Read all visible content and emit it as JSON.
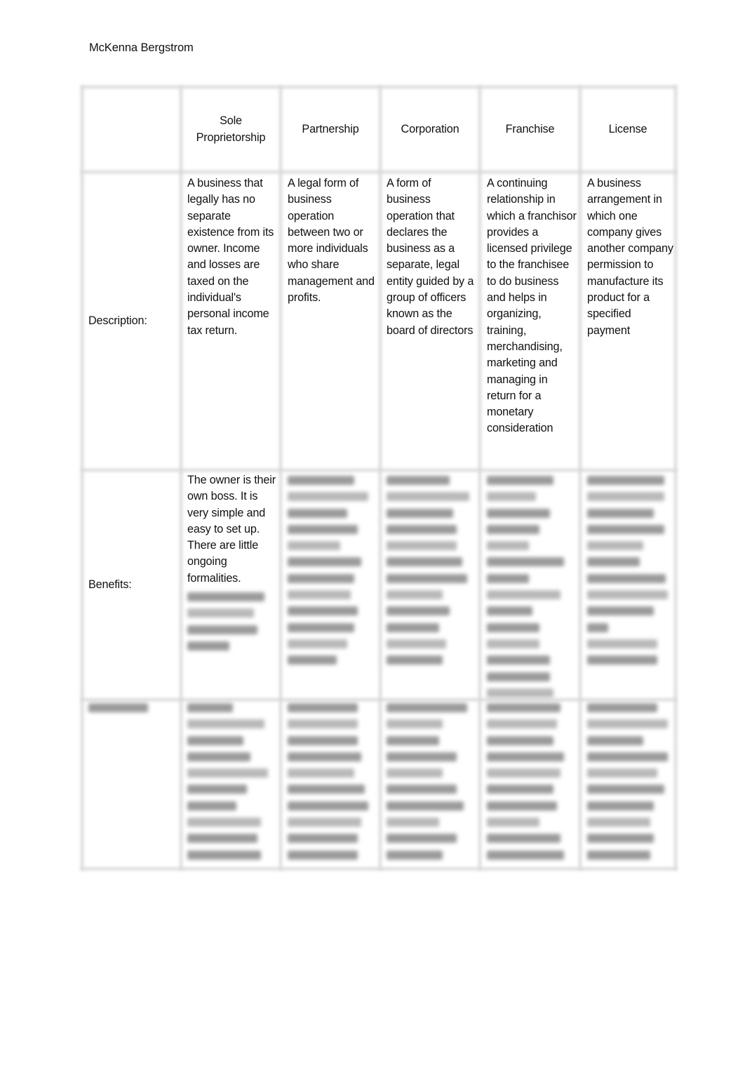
{
  "document": {
    "author": "McKenna Bergstrom"
  },
  "table": {
    "columns": [
      "",
      "Sole Proprietorship",
      "Partnership",
      "Corporation",
      "Franchise",
      "License"
    ],
    "header_lines": {
      "sole": [
        "Sole",
        "Proprietorship"
      ]
    },
    "rows": [
      {
        "label": "Description:",
        "cells": [
          "A business that legally has no separate existence from its owner. Income and losses are taxed on the individual's personal income tax return.",
          "A legal form of business operation between two or more individuals who share management and profits.",
          "A form of business operation that declares the business as a separate, legal entity guided by a group of officers known as the board of directors",
          "A continuing relationship in which a franchisor provides a licensed privilege to the franchisee to do business and helps in organizing, training, merchandising, marketing and managing in return for a monetary consideration",
          "A business arrangement in which one company gives another company permission to manufacture its product for a specified payment"
        ]
      },
      {
        "label": "Benefits:",
        "cells": [
          "The owner is their own boss. It is very simple and easy to set up. There are little ongoing formalities.",
          null,
          null,
          null,
          null
        ],
        "blurred_note": "remaining content obscured (blurred preview)"
      },
      {
        "label": null,
        "cells": [
          null,
          null,
          null,
          null,
          null
        ],
        "blurred_note": "entire row obscured (blurred preview)"
      }
    ]
  }
}
